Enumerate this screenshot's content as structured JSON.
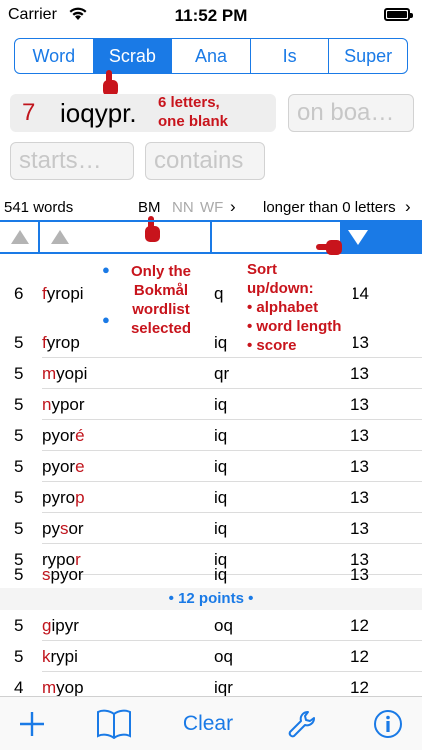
{
  "status": {
    "carrier": "Carrier",
    "time": "11:52 PM"
  },
  "modes": [
    "Word",
    "Scrab",
    "Ana",
    "Is",
    "Super"
  ],
  "active_mode": "Scrab",
  "rack": {
    "count": "7",
    "letters": "ioqypr."
  },
  "fields": {
    "on_board": "on boa…",
    "starts": "starts…",
    "contains": "contains"
  },
  "annotations": {
    "letters_note_1": "6 letters,",
    "letters_note_2": "one blank",
    "wordlist_note_1": "Only the",
    "wordlist_note_2": "Bokmål",
    "wordlist_note_3": "wordlist",
    "wordlist_note_4": "selected",
    "sort_note_1": "Sort",
    "sort_note_2": "up/down:",
    "sort_note_3": "• alphabet",
    "sort_note_4": "• word length",
    "sort_note_5": "• score"
  },
  "info": {
    "word_count": "541 words",
    "lists": {
      "bm": "BM",
      "nn": "NN",
      "wf": "WF"
    },
    "filter": "longer than 0 letters"
  },
  "colors": {
    "accent": "#1a7ae6",
    "highlight": "#c0141c"
  },
  "sections": {
    "points12": "• 12 points •"
  },
  "rows": [
    {
      "len": "6",
      "pre": "",
      "hl": "f",
      "post": "yropi",
      "extra": "q",
      "score": "14"
    },
    {
      "len": "5",
      "pre": "",
      "hl": "f",
      "post": "yrop",
      "extra": "iq",
      "score": "13"
    },
    {
      "len": "5",
      "pre": "",
      "hl": "m",
      "post": "yopi",
      "extra": "qr",
      "score": "13"
    },
    {
      "len": "5",
      "pre": "",
      "hl": "n",
      "post": "ypor",
      "extra": "iq",
      "score": "13"
    },
    {
      "len": "5",
      "pre": "pyor",
      "hl": "é",
      "post": "",
      "extra": "iq",
      "score": "13"
    },
    {
      "len": "5",
      "pre": "pyor",
      "hl": "e",
      "post": "",
      "extra": "iq",
      "score": "13"
    },
    {
      "len": "5",
      "pre": "pyro",
      "hl": "p",
      "post": "",
      "extra": "iq",
      "score": "13"
    },
    {
      "len": "5",
      "pre": "py",
      "hl": "s",
      "post": "or",
      "extra": "iq",
      "score": "13"
    },
    {
      "len": "5",
      "pre": "rypo",
      "hl": "r",
      "post": "",
      "extra": "iq",
      "score": "13"
    },
    {
      "len": "5",
      "pre": "",
      "hl": "s",
      "post": "pyor",
      "extra": "iq",
      "score": "13"
    },
    {
      "len": "5",
      "pre": "",
      "hl": "g",
      "post": "ipyr",
      "extra": "oq",
      "score": "12"
    },
    {
      "len": "5",
      "pre": "",
      "hl": "k",
      "post": "rypi",
      "extra": "oq",
      "score": "12"
    },
    {
      "len": "4",
      "pre": "",
      "hl": "m",
      "post": "yop",
      "extra": "iqr",
      "score": "12"
    }
  ],
  "tabbar": {
    "clear": "Clear"
  }
}
